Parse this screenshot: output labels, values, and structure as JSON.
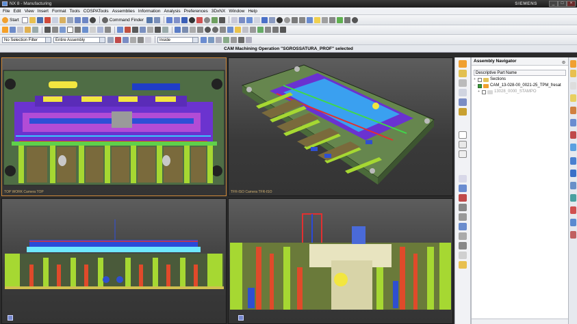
{
  "window": {
    "title": "NX 8 - Manufacturing",
    "brand": "SIEMENS"
  },
  "menu": [
    "File",
    "Edit",
    "View",
    "Insert",
    "Format",
    "Tools",
    "COSPATools",
    "Assemblies",
    "Information",
    "Analysis",
    "Preferences",
    "3DxNX",
    "Window",
    "Help"
  ],
  "toolbar": {
    "start_label": "Start",
    "command_finder_label": "Command Finder"
  },
  "selection_bar": {
    "filter": "No Selection Filter",
    "scope": "Entire Assembly",
    "mode": "Inside"
  },
  "status_message": "CAM Machining Operation \"SGROSSATURA_PROF\" selected",
  "viewports": [
    {
      "label": "TOP WORK Camera TOP"
    },
    {
      "label": "TFR-ISO Camera TFR-ISO"
    },
    {
      "label": ""
    },
    {
      "label": ""
    }
  ],
  "assembly_navigator": {
    "title": "Assembly Navigator",
    "column_header": "Descriptive Part Name",
    "items": [
      {
        "label": "Sections",
        "expanded": false
      },
      {
        "label": "CAM_13-028-00_0021-25_TPM_fresat",
        "expanded": true
      },
      {
        "label": "13028_0000_STAMPO",
        "expanded": false
      }
    ]
  },
  "colors": {
    "selected_viewport_border": "#d08a3a",
    "menu_bg": "#eef0f4",
    "viewport_bg": "#4a4a4a"
  }
}
